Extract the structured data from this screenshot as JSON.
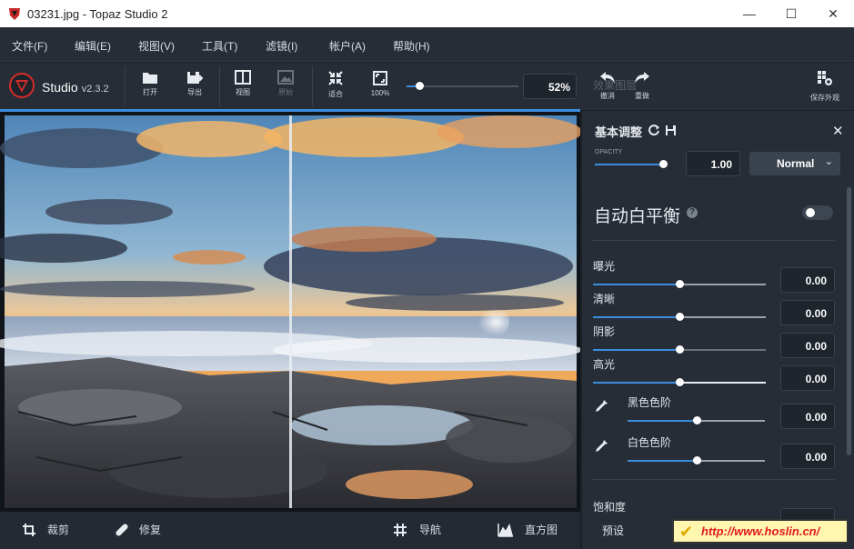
{
  "window": {
    "title": "03231.jpg - Topaz Studio 2",
    "minimize": "—",
    "maximize": "☐",
    "close": "✕"
  },
  "menu": [
    "文件(F)",
    "编辑(E)",
    "视图(V)",
    "工具(T)",
    "滤镜(I)",
    "帐户(A)",
    "帮助(H)"
  ],
  "brand": {
    "name": "Studio",
    "version": "v2.3.2"
  },
  "toolbar": {
    "open": "打开",
    "export": "导出",
    "view": "视图",
    "original": "原始",
    "fit": "适合",
    "zoom100": "100%",
    "zoom_value": "52%",
    "ghost_label": "效果图层"
  },
  "zoom": {
    "level": 0.05
  },
  "right_toolbar": {
    "undo": "撤消",
    "redo": "重做",
    "save_look": "保存外观"
  },
  "panel": {
    "header": "基本调整",
    "opacity_label": "OPACITY",
    "opacity_value": "1.00",
    "opacity_level": 1.0,
    "blend_mode": "Normal",
    "auto_wb_label": "自动白平衡",
    "auto_wb_enabled": false,
    "sliders": [
      {
        "label": "曝光",
        "value": "0.00",
        "level": 0.5
      },
      {
        "label": "清晰",
        "value": "0.00",
        "level": 0.5
      },
      {
        "label": "阴影",
        "value": "0.00",
        "level": 0.5
      },
      {
        "label": "高光",
        "value": "0.00",
        "level": 0.5
      },
      {
        "label": "黑色色阶",
        "value": "0.00",
        "level": 0.5
      },
      {
        "label": "白色色阶",
        "value": "0.00",
        "level": 0.5
      }
    ],
    "saturation_label": "饱和度"
  },
  "bottombar": {
    "crop": "裁剪",
    "repair": "修复",
    "navigate": "导航",
    "histogram": "直方图",
    "preset": "预设"
  },
  "watermark": "http://www.hoslin.cn/",
  "colors": {
    "accent": "#3b8de0",
    "bg": "#1c2128",
    "panel": "#262d36",
    "logo_red": "#d62b2b"
  }
}
